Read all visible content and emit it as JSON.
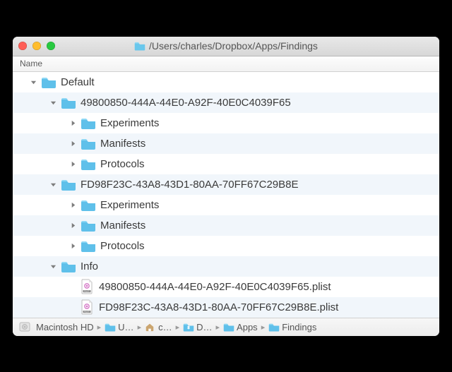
{
  "window": {
    "title": "/Users/charles/Dropbox/Apps/Findings"
  },
  "columns": {
    "header": "Name"
  },
  "tree": [
    {
      "name": "Default",
      "icon": "folder",
      "expanded": true,
      "level": 0
    },
    {
      "name": "49800850-444A-44E0-A92F-40E0C4039F65",
      "icon": "folder",
      "expanded": true,
      "level": 1
    },
    {
      "name": "Experiments",
      "icon": "folder",
      "expanded": false,
      "level": 2
    },
    {
      "name": "Manifests",
      "icon": "folder",
      "expanded": false,
      "level": 2
    },
    {
      "name": "Protocols",
      "icon": "folder",
      "expanded": false,
      "level": 2
    },
    {
      "name": "FD98F23C-43A8-43D1-80AA-70FF67C29B8E",
      "icon": "folder",
      "expanded": true,
      "level": 1
    },
    {
      "name": "Experiments",
      "icon": "folder",
      "expanded": false,
      "level": 2
    },
    {
      "name": "Manifests",
      "icon": "folder",
      "expanded": false,
      "level": 2
    },
    {
      "name": "Protocols",
      "icon": "folder",
      "expanded": false,
      "level": 2
    },
    {
      "name": "Info",
      "icon": "folder",
      "expanded": true,
      "level": 1
    },
    {
      "name": "49800850-444A-44E0-A92F-40E0C4039F65.plist",
      "icon": "plist",
      "expanded": null,
      "level": 2
    },
    {
      "name": "FD98F23C-43A8-43D1-80AA-70FF67C29B8E.plist",
      "icon": "plist",
      "expanded": null,
      "level": 2
    }
  ],
  "path": [
    {
      "label": "Macintosh HD",
      "icon": "hd"
    },
    {
      "label": "U…",
      "icon": "folder"
    },
    {
      "label": "c…",
      "icon": "home"
    },
    {
      "label": "D…",
      "icon": "dropbox"
    },
    {
      "label": "Apps",
      "icon": "folder"
    },
    {
      "label": "Findings",
      "icon": "folder"
    }
  ]
}
